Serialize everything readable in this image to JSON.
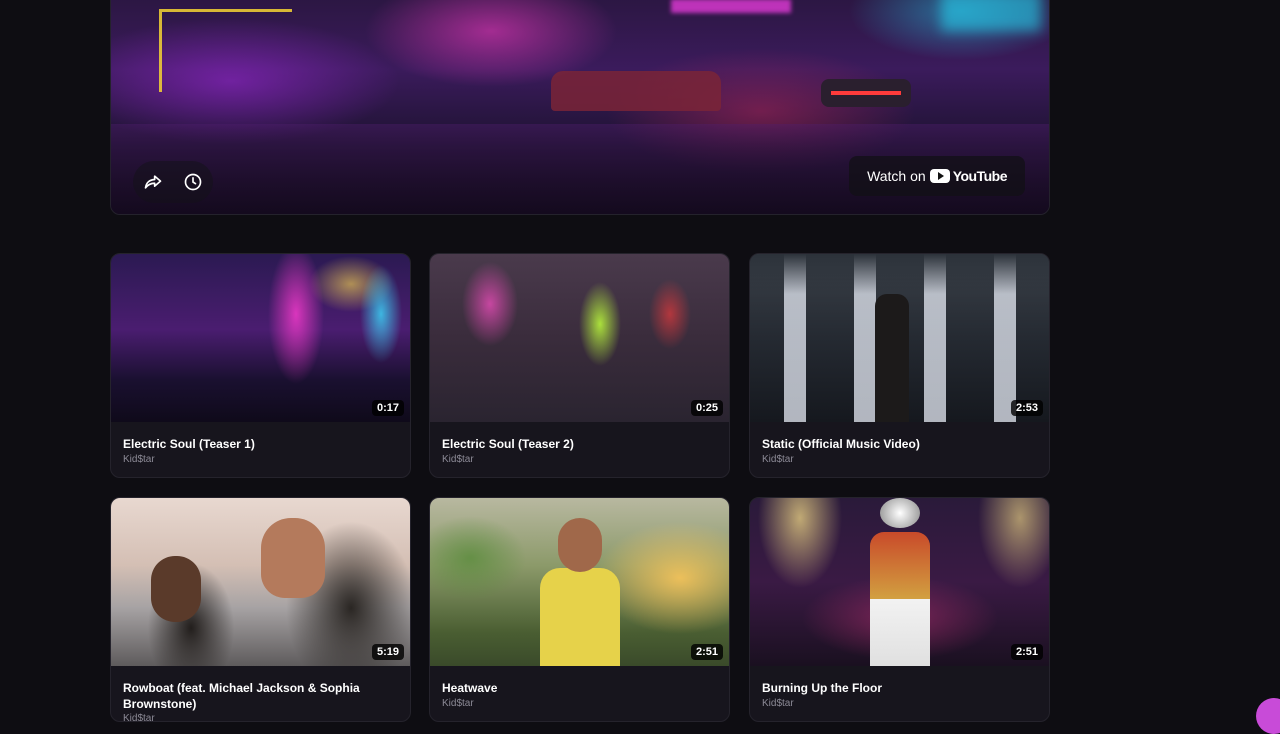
{
  "player": {
    "share_icon": "share-icon",
    "watch_later_icon": "clock-icon",
    "watch_on_label": "Watch on",
    "youtube_label": "YouTube"
  },
  "videos": [
    {
      "title": "Electric Soul (Teaser 1)",
      "author": "Kid$tar",
      "duration": "0:17"
    },
    {
      "title": "Electric Soul (Teaser 2)",
      "author": "Kid$tar",
      "duration": "0:25"
    },
    {
      "title": "Static (Official Music Video)",
      "author": "Kid$tar",
      "duration": "2:53"
    },
    {
      "title": "Rowboat (feat. Michael Jackson & Sophia Brownstone)",
      "author": "Kid$tar",
      "duration": "5:19"
    },
    {
      "title": "Heatwave",
      "author": "Kid$tar",
      "duration": "2:51"
    },
    {
      "title": "Burning Up the Floor",
      "author": "Kid$tar",
      "duration": "2:51"
    }
  ]
}
